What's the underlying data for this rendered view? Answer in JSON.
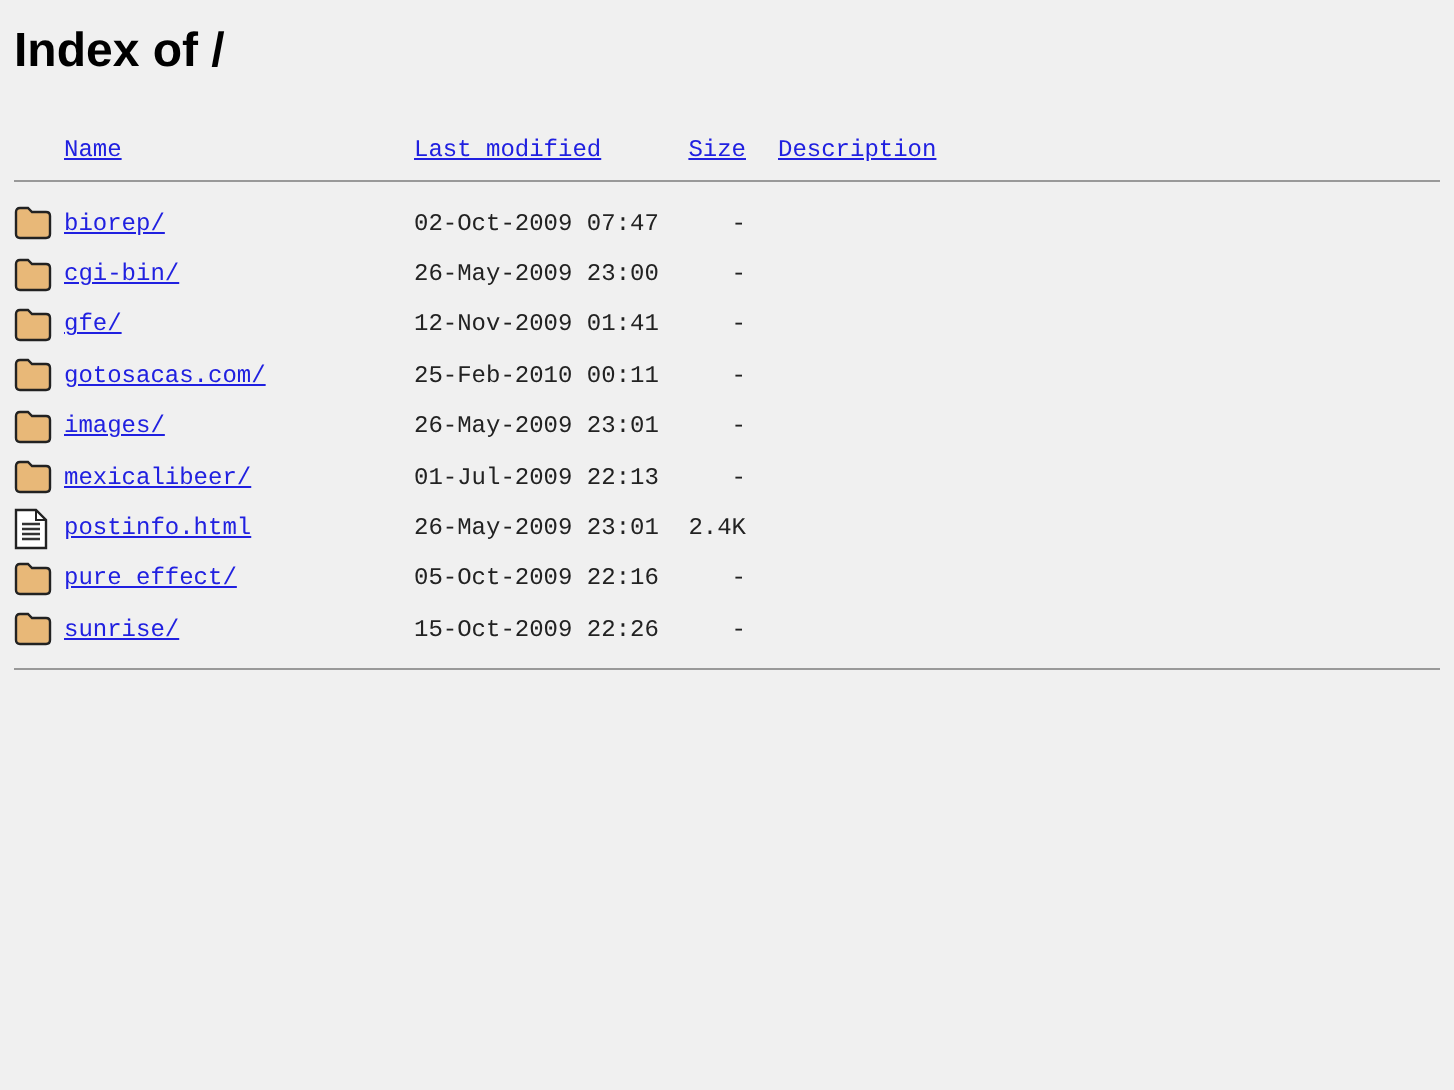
{
  "title": "Index of /",
  "columns": [
    "Name",
    "Last modified",
    "Size",
    "Description"
  ],
  "rows": [
    {
      "kind": "folder",
      "name": "biorep/",
      "modified": "02-Oct-2009 07:47",
      "size": "-"
    },
    {
      "kind": "folder",
      "name": "cgi-bin/",
      "modified": "26-May-2009 23:00",
      "size": "-"
    },
    {
      "kind": "folder",
      "name": "gfe/",
      "modified": "12-Nov-2009 01:41",
      "size": "-"
    },
    {
      "kind": "folder",
      "name": "gotosacas.com/",
      "modified": "25-Feb-2010 00:11",
      "size": "-"
    },
    {
      "kind": "folder",
      "name": "images/",
      "modified": "26-May-2009 23:01",
      "size": "-"
    },
    {
      "kind": "folder",
      "name": "mexicalibeer/",
      "modified": "01-Jul-2009 22:13",
      "size": "-"
    },
    {
      "kind": "file",
      "name": "postinfo.html",
      "modified": "26-May-2009 23:01",
      "size": "2.4K"
    },
    {
      "kind": "folder",
      "name": "pure effect/",
      "modified": "05-Oct-2009 22:16",
      "size": "-"
    },
    {
      "kind": "folder",
      "name": "sunrise/",
      "modified": "15-Oct-2009 22:26",
      "size": "-"
    }
  ]
}
